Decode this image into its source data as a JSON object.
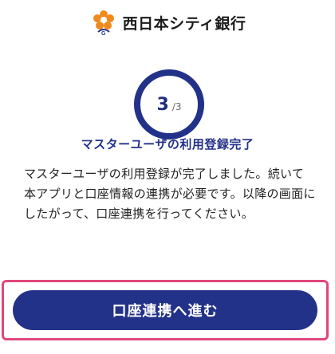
{
  "header": {
    "bank_name": "西日本シティ銀行",
    "logo_icon": "flower-logo-icon",
    "logo_color": "#f08a1c"
  },
  "progress": {
    "current": "3",
    "total": "/3",
    "fraction_complete": 1.0,
    "ring_color": "#233289",
    "title": "マスターユーザの利用登録完了"
  },
  "message": {
    "text": "マスターユーザの利用登録が完了しました。続いて本アプリと口座情報の連携が必要です。以降の画面にしたがって、口座連携を行ってください。"
  },
  "cta": {
    "label": "口座連携へ進む",
    "background": "#233289",
    "highlight_color": "#e0487a"
  }
}
